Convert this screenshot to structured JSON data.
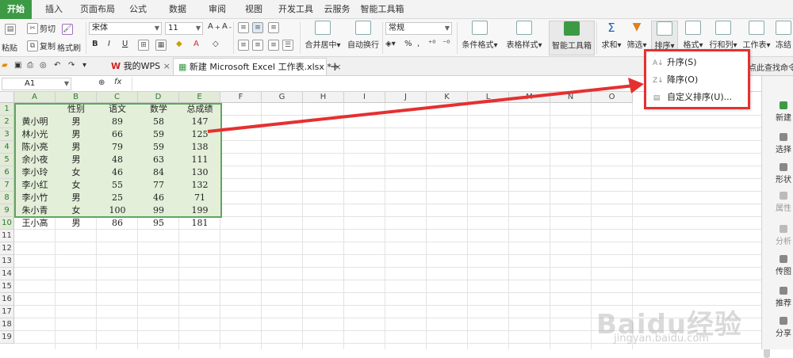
{
  "menu": {
    "tabs": [
      "开始",
      "插入",
      "页面布局",
      "公式",
      "数据",
      "审阅",
      "视图",
      "开发工具",
      "云服务",
      "智能工具箱"
    ],
    "active": 0
  },
  "ribbon": {
    "paste": "粘贴",
    "cut": "剪切",
    "copy": "复制",
    "format_painter": "格式刷",
    "font_name": "宋体",
    "font_size": "11",
    "merge_center": "合并居中",
    "wrap_text": "自动换行",
    "number_format": "常规",
    "cond_format": "条件格式",
    "table_style": "表格样式",
    "smart_toolbox": "智能工具箱",
    "sum": "求和",
    "filter": "筛选",
    "sort": "排序",
    "format": "格式",
    "row_col": "行和列",
    "worksheet": "工作表",
    "freeze": "冻结"
  },
  "doc_tabs": {
    "mywps": "我的WPS",
    "file": "新建 Microsoft Excel 工作表.xlsx *",
    "find_cmd": "点此查找命令"
  },
  "formula_bar": {
    "cell_ref": "A1",
    "fx": "fx"
  },
  "sheet": {
    "columns": [
      "A",
      "B",
      "C",
      "D",
      "E",
      "F",
      "G",
      "H",
      "I",
      "J",
      "K",
      "L",
      "M",
      "N",
      "O"
    ],
    "rows": [
      "1",
      "2",
      "3",
      "4",
      "5",
      "6",
      "7",
      "8",
      "9",
      "10",
      "11",
      "12",
      "13",
      "14",
      "15",
      "16",
      "17",
      "18",
      "19"
    ],
    "header_row": [
      "",
      "性别",
      "语文",
      "数学",
      "总成绩"
    ],
    "data": [
      [
        "黄小明",
        "男",
        "89",
        "58",
        "147"
      ],
      [
        "林小光",
        "男",
        "66",
        "59",
        "125"
      ],
      [
        "陈小亮",
        "男",
        "79",
        "59",
        "138"
      ],
      [
        "余小夜",
        "男",
        "48",
        "63",
        "111"
      ],
      [
        "李小玲",
        "女",
        "46",
        "84",
        "130"
      ],
      [
        "李小红",
        "女",
        "55",
        "77",
        "132"
      ],
      [
        "李小竹",
        "男",
        "25",
        "46",
        "71"
      ],
      [
        "朱小青",
        "女",
        "100",
        "99",
        "199"
      ],
      [
        "王小高",
        "男",
        "86",
        "95",
        "181"
      ]
    ]
  },
  "sort_menu": {
    "asc": "升序(S)",
    "desc": "降序(O)",
    "custom": "自定义排序(U)..."
  },
  "sidebar": [
    "新建",
    "选择",
    "形状",
    "属性",
    "分析",
    "传图",
    "推荐",
    "分享"
  ],
  "watermark": {
    "brand": "Baidu经验",
    "url": "jingyan.baidu.com"
  },
  "colors": {
    "accent": "#3c9a45",
    "annotation": "#e53030",
    "selection_fill": "#e4efd9"
  }
}
